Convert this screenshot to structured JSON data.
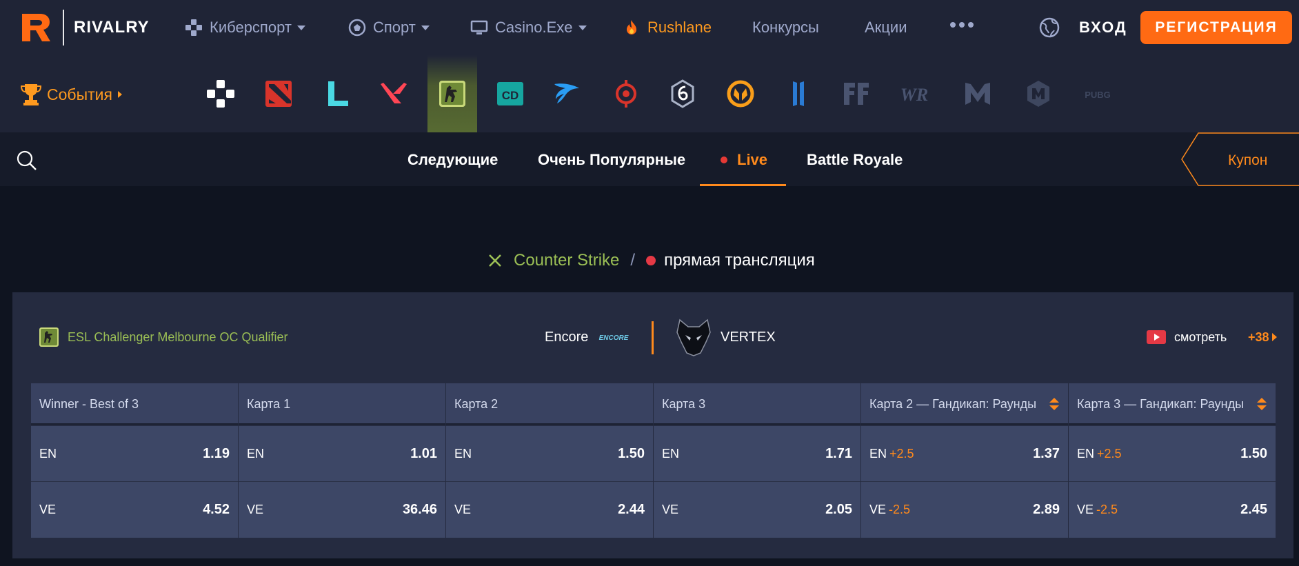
{
  "header": {
    "logo_text": "RIVALRY",
    "nav": [
      {
        "label": "Киберспорт",
        "icon": "gamepad-icon"
      },
      {
        "label": "Спорт",
        "icon": "soccer-ball-icon"
      },
      {
        "label": "Casino.Exe",
        "icon": "monitor-icon"
      },
      {
        "label": "Rushlane",
        "icon": "flame-icon"
      },
      {
        "label": "Конкурсы"
      },
      {
        "label": "Акции"
      }
    ],
    "login_label": "ВХОД",
    "register_label": "РЕГИСТРАЦИЯ"
  },
  "gamesbar": {
    "events_label": "События",
    "games": [
      "all-esports",
      "dota-2",
      "league-of-legends",
      "valorant",
      "counter-strike",
      "call-of-duty",
      "rocket-league",
      "king-of-glory",
      "rainbow-six",
      "overwatch",
      "starcraft",
      "free-fire",
      "wild-rift",
      "mobile-legends",
      "arena-of-valor",
      "pubg"
    ],
    "active_game": "counter-strike"
  },
  "tabs": {
    "items": [
      "Следующие",
      "Очень Популярные",
      "Live",
      "Battle Royale"
    ],
    "active": "Live",
    "coupon_label": "Купон"
  },
  "breadcrumb": {
    "sport": "Counter Strike",
    "separator": "/",
    "status": "прямая трансляция"
  },
  "match": {
    "league": "ESL Challenger Melbourne OC Qualifier",
    "team1": "Encore",
    "team1_logo_text": "ENCORE",
    "team2": "VERTEX",
    "watch_label": "смотреть",
    "more_markets": "+38",
    "markets": [
      {
        "title": "Winner - Best of 3",
        "rows": [
          {
            "label": "EN",
            "handicap": "",
            "odd": "1.19"
          },
          {
            "label": "VE",
            "handicap": "",
            "odd": "4.52"
          }
        ]
      },
      {
        "title": "Карта 1",
        "rows": [
          {
            "label": "EN",
            "handicap": "",
            "odd": "1.01"
          },
          {
            "label": "VE",
            "handicap": "",
            "odd": "36.46"
          }
        ]
      },
      {
        "title": "Карта 2",
        "rows": [
          {
            "label": "EN",
            "handicap": "",
            "odd": "1.50"
          },
          {
            "label": "VE",
            "handicap": "",
            "odd": "2.44"
          }
        ]
      },
      {
        "title": "Карта 3",
        "rows": [
          {
            "label": "EN",
            "handicap": "",
            "odd": "1.71"
          },
          {
            "label": "VE",
            "handicap": "",
            "odd": "2.05"
          }
        ]
      },
      {
        "title": "Карта 2 — Гандикап: Раунды",
        "rows": [
          {
            "label": "EN",
            "handicap": "+2.5",
            "odd": "1.37"
          },
          {
            "label": "VE",
            "handicap": "-2.5",
            "odd": "2.89"
          }
        ]
      },
      {
        "title": "Карта 3 — Гандикап: Раунды",
        "rows": [
          {
            "label": "EN",
            "handicap": "+2.5",
            "odd": "1.50"
          },
          {
            "label": "VE",
            "handicap": "-2.5",
            "odd": "2.45"
          }
        ]
      }
    ]
  },
  "colors": {
    "accent": "#ff6a13",
    "accent_text": "#ff8a1c",
    "sport_green": "#9bbf55",
    "live_red": "#e53945",
    "header_bg": "#1f2436",
    "page_bg": "#0f1420",
    "card_bg": "#252b40",
    "cell_bg": "#3d4766"
  }
}
